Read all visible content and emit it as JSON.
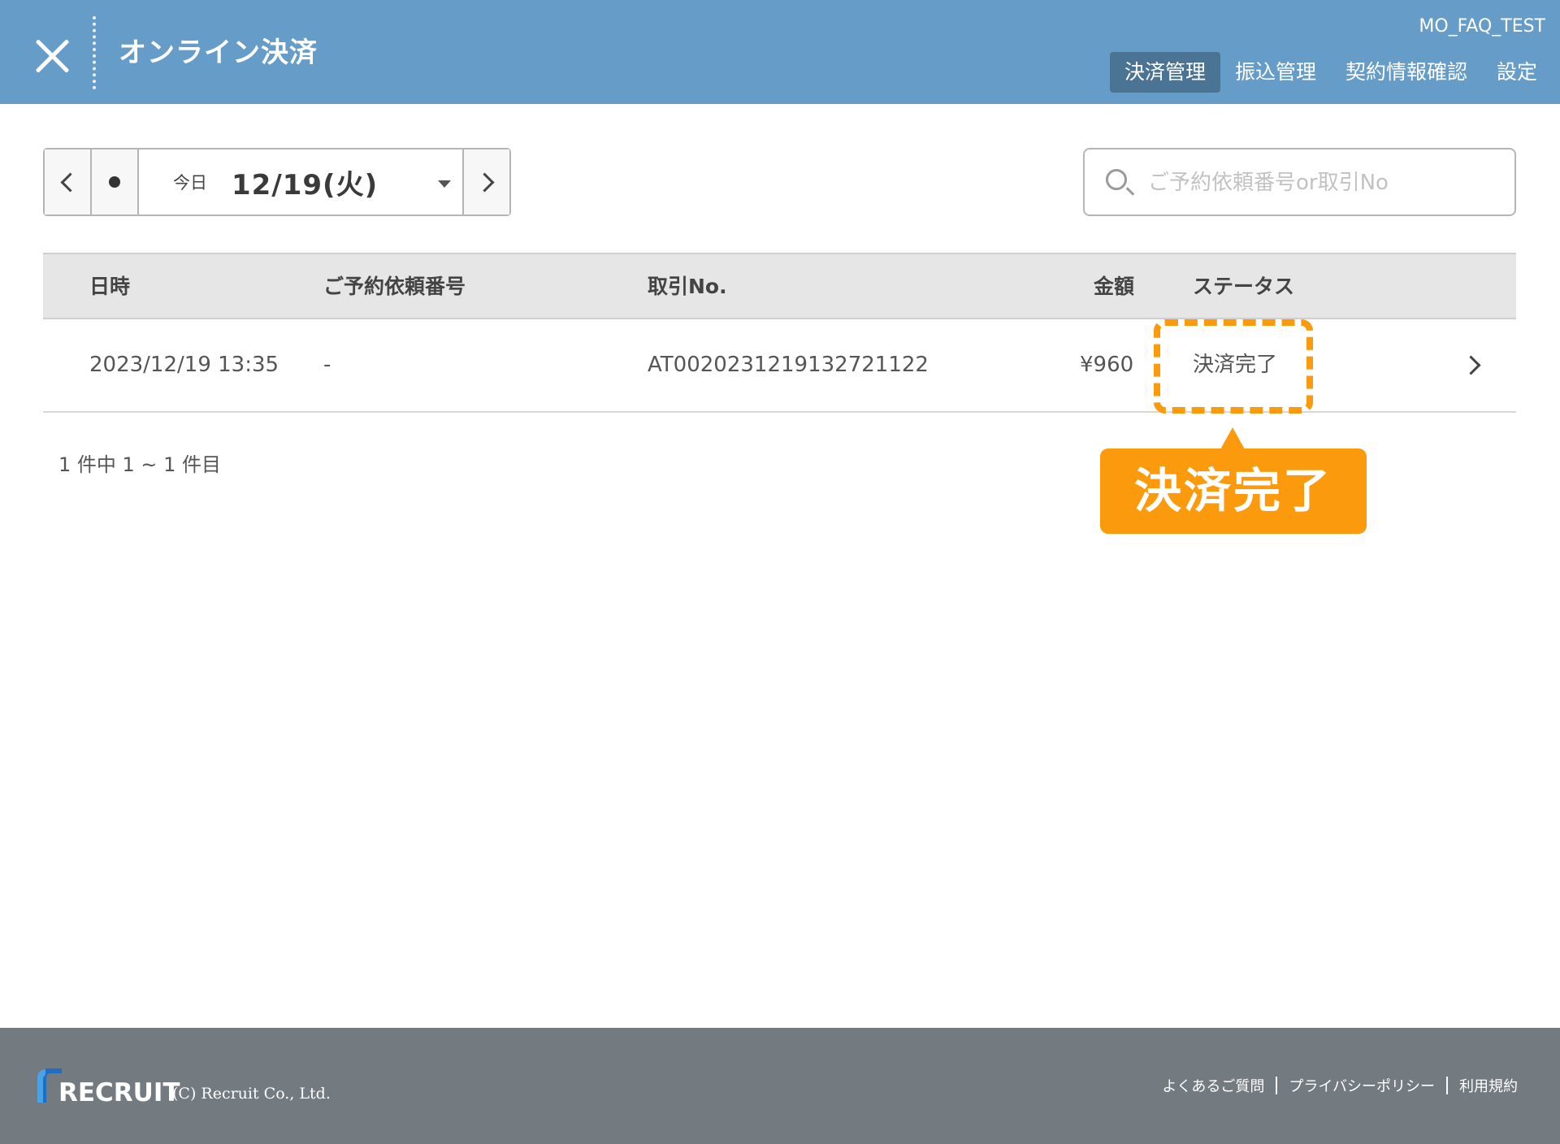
{
  "header": {
    "title": "オンライン決済",
    "user": "MO_FAQ_TEST",
    "nav": [
      {
        "label": "決済管理",
        "active": true
      },
      {
        "label": "振込管理",
        "active": false
      },
      {
        "label": "契約情報確認",
        "active": false
      },
      {
        "label": "設定",
        "active": false
      }
    ]
  },
  "date_nav": {
    "today_label": "今日",
    "date": "12/19(火)"
  },
  "search": {
    "placeholder": "ご予約依頼番号or取引No",
    "value": ""
  },
  "table": {
    "columns": [
      "日時",
      "ご予約依頼番号",
      "取引No.",
      "金額",
      "ステータス"
    ],
    "rows": [
      {
        "datetime": "2023/12/19 13:35",
        "reservation_no": "-",
        "transaction_no": "AT002023121913 2721122",
        "amount": "¥960",
        "status": "決済完了"
      }
    ]
  },
  "callout": {
    "label": "決済完了",
    "color": "#fc9a0d"
  },
  "pagination": "1 件中 1 ~ 1 件目",
  "footer": {
    "logo_text": "RECRUIT",
    "copyright": "(C) Recruit Co., Ltd.",
    "links": [
      "よくあるご質問",
      "プライバシーポリシー",
      "利用規約"
    ]
  },
  "colors": {
    "header_bg": "#659cc8",
    "active_tab_bg": "#4b7393",
    "footer_bg": "#737a80",
    "highlight": "#fc9a0d"
  }
}
